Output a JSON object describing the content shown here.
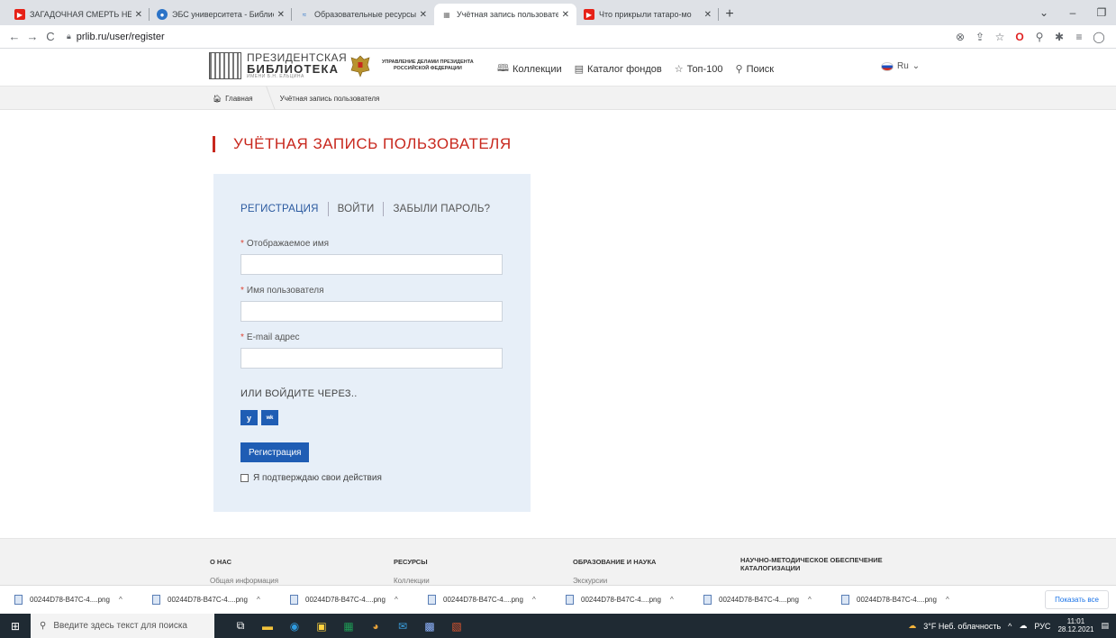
{
  "browser": {
    "tabs": [
      {
        "title": "ЗАГАДОЧНАЯ СМЕРТЬ НЕВЕСТЫ",
        "icon": "youtube-icon",
        "color": "#e62117",
        "active": false
      },
      {
        "title": "ЭБС университета - Библиотека",
        "icon": "globe-icon",
        "color": "#2b73c7",
        "active": false
      },
      {
        "title": "Образовательные ресурсы биб",
        "icon": "wave-icon",
        "color": "#2b73c7",
        "active": false
      },
      {
        "title": "Учётная запись пользователя |",
        "icon": "library-icon",
        "color": "#777777",
        "active": true
      },
      {
        "title": "Что прикрыли татаро-мо",
        "icon": "youtube-icon",
        "color": "#e62117",
        "active": false
      }
    ],
    "new_tab": "+",
    "url": "prlib.ru/user/register"
  },
  "site": {
    "logo_line1": "ПРЕЗИДЕНТСКАЯ",
    "logo_line2": "БИБЛИОТЕКА",
    "logo_line3": "ИМЕНИ Б.Н. ЕЛЬЦИНА",
    "admin_line1": "УПРАВЛЕНИЕ ДЕЛАМИ ПРЕЗИДЕНТА",
    "admin_line2": "РОССИЙСКОЙ ФЕДЕРАЦИИ",
    "nav": [
      {
        "label": "Коллекции",
        "icon": "book-icon"
      },
      {
        "label": "Каталог фондов",
        "icon": "catalog-icon"
      },
      {
        "label": "Топ-100",
        "icon": "star-icon"
      },
      {
        "label": "Поиск",
        "icon": "search-icon"
      }
    ],
    "language": "Ru"
  },
  "breadcrumb": {
    "home": "Главная",
    "current": "Учётная запись пользователя"
  },
  "page_title": "УЧЁТНАЯ ЗАПИСЬ ПОЛЬЗОВАТЕЛЯ",
  "form": {
    "tabs": {
      "register": "РЕГИСТРАЦИЯ",
      "login": "ВОЙТИ",
      "forgot": "ЗАБЫЛИ ПАРОЛЬ?"
    },
    "fields": {
      "display_name": {
        "label": "Отображаемое имя",
        "value": ""
      },
      "username": {
        "label": "Имя пользователя",
        "value": ""
      },
      "email": {
        "label": "E-mail адрес",
        "value": ""
      }
    },
    "required_mark": "*",
    "or_login_via": "ИЛИ ВОЙДИТЕ ЧЕРЕЗ..",
    "social": {
      "twitter": "y",
      "vk": "ʷᵏ"
    },
    "submit": "Регистрация",
    "confirm": "Я подтверждаю свои действия"
  },
  "footer": {
    "columns": [
      {
        "heading": "О НАС",
        "link": "Общая информация"
      },
      {
        "heading": "РЕСУРСЫ",
        "link": "Коллекции"
      },
      {
        "heading": "ОБРАЗОВАНИЕ И НАУКА",
        "link": "Экскурсии"
      },
      {
        "heading": "НАУЧНО-МЕТОДИЧЕСКОЕ ОБЕСПЕЧЕНИЕ КАТАЛОГИЗАЦИИ",
        "link": ""
      }
    ]
  },
  "downloads": {
    "items": [
      "00244D78-B47C-4....png",
      "00244D78-B47C-4....png",
      "00244D78-B47C-4....png",
      "00244D78-B47C-4....png",
      "00244D78-B47C-4....png",
      "00244D78-B47C-4....png",
      "00244D78-B47C-4....png"
    ],
    "show_all": "Показать все"
  },
  "taskbar": {
    "search_placeholder": "Введите здесь текст для поиска",
    "weather": "3°F  Неб. облачность",
    "lang": "РУС",
    "time": "11:01",
    "date": "28.12.2021"
  },
  "colors": {
    "accent": "#c8281e",
    "primary": "#1f5db4",
    "card_bg": "#e7eff8"
  }
}
